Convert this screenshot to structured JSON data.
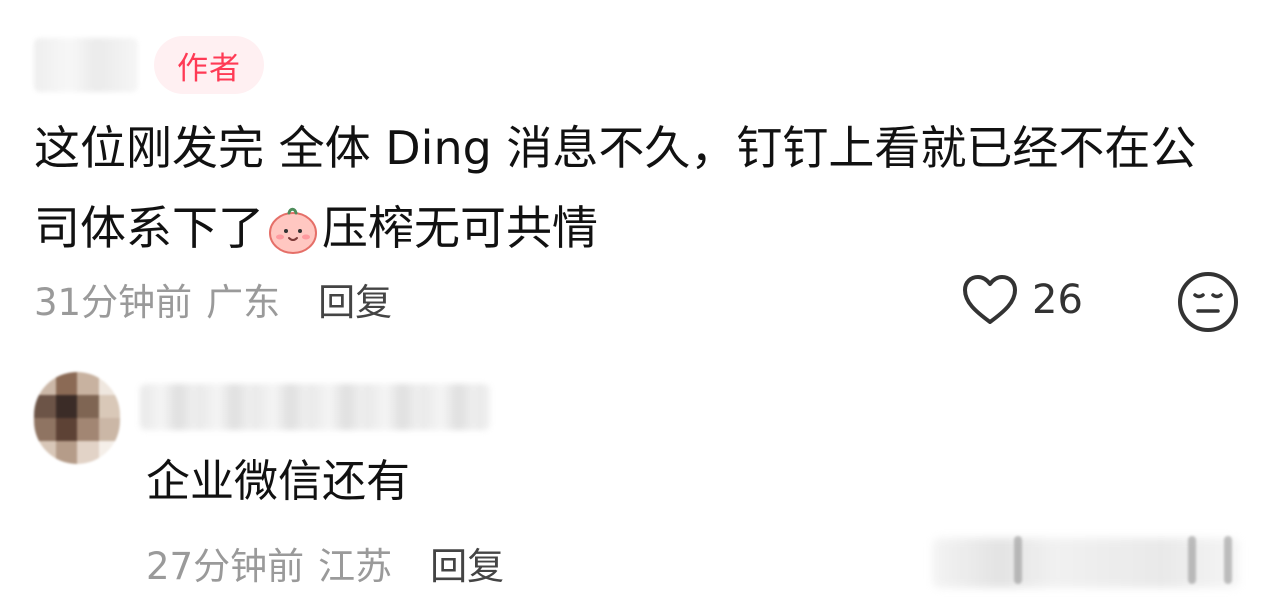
{
  "comment": {
    "author_badge": "作者",
    "text_line1": "这位刚发完 全体 Ding 消息不久，钉钉上看就已经不在公",
    "text_line2_before_emoji": "司体系下了",
    "emoji_name": "blushing-face-emoji",
    "text_line2_after_emoji": "压榨无可共情",
    "time": "31分钟前",
    "location": "广东",
    "reply_label": "回复",
    "likes": "26",
    "colors": {
      "badge_text": "#ff3a55",
      "badge_bg": "#fff0f2",
      "meta_text": "#9a9a9a"
    }
  },
  "reply": {
    "text": "企业微信还有",
    "time": "27分钟前",
    "location": "江苏",
    "reply_label": "回复"
  },
  "icons": {
    "like": "heart-outline-icon",
    "reaction": "neutral-face-icon"
  }
}
